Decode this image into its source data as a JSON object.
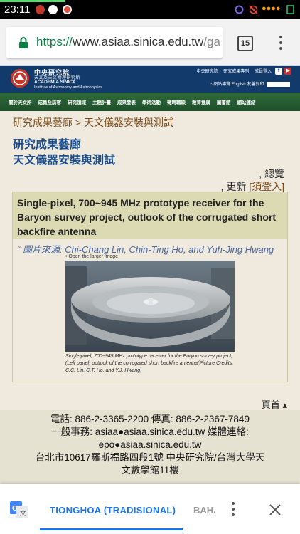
{
  "status_bar": {
    "time": "23:11"
  },
  "browser": {
    "url_scheme": "https://",
    "url_host": "www.asiaa.sinica.edu.tw",
    "url_path": "/ga",
    "tab_count": "15"
  },
  "site": {
    "inst_name_cn": "中央研究院",
    "inst_sub_cn": "天文及天文物理研究所",
    "inst_name_en": "ACADEMIA SINICA",
    "inst_sub_en": "Institute of Astronomy and Astrophysics",
    "top_links": [
      "中央研究院",
      "研究成果專刊",
      "成員登入"
    ],
    "tools": [
      "網站導覽",
      "English",
      "友善列印"
    ]
  },
  "nav": {
    "items": [
      "關於天文所",
      "成員及訪客",
      "研究領域",
      "主題計畫",
      "成果發表",
      "學術活動",
      "徵聘職缺",
      "教育推廣",
      "圖書館",
      "網站連結"
    ]
  },
  "page": {
    "breadcrumb": "研究成果藝廊 > 天文儀器安裝與測試",
    "title": "研究成果藝廊",
    "subtitle": "天文儀器安裝與測試",
    "overview": ", 總覽",
    "update_prefix": ", 更新",
    "login_link": "[須登入]"
  },
  "article": {
    "title": "Single-pixel, 700~945 MHz prototype receiver for the Baryon survey project, outlook of the corrugated short backfire antenna",
    "credit": "“ 圖片來源: Chi-Chang Lin, Chin-Ting Ho, and Yuh-Jing Hwang",
    "open_larger": "• Open the larger image",
    "caption": "Single-pixel, 700~945 MHz prototype receiver for the Baryon survey project, (Left panel) outlook of the corrugated short backfire antenna(Picture Credits: C.C. Lin, C.T. Ho, and Y.J. Hwang)"
  },
  "footer": {
    "top_link": "頁首",
    "line1": "電話: 886-2-3365-2200 傳真: 886-2-2367-7849",
    "line2": "一般事務: asiaa●asiaa.sinica.edu.tw 媒體連絡:",
    "line3": "epo●asiaa.sinica.edu.tw",
    "line4": "台北市10617羅斯福路四段1號 中央研究院/台灣大學天",
    "line5": "文數學館11樓"
  },
  "translate": {
    "active_language": "TIONGHOA (TRADISIONAL)",
    "other_language": "BAHASA"
  },
  "colors": {
    "header_blue": "#123a6b",
    "nav_green": "#2f6a3a",
    "title_blue": "#1a4c8a",
    "accent_blue": "#1a73e8"
  }
}
